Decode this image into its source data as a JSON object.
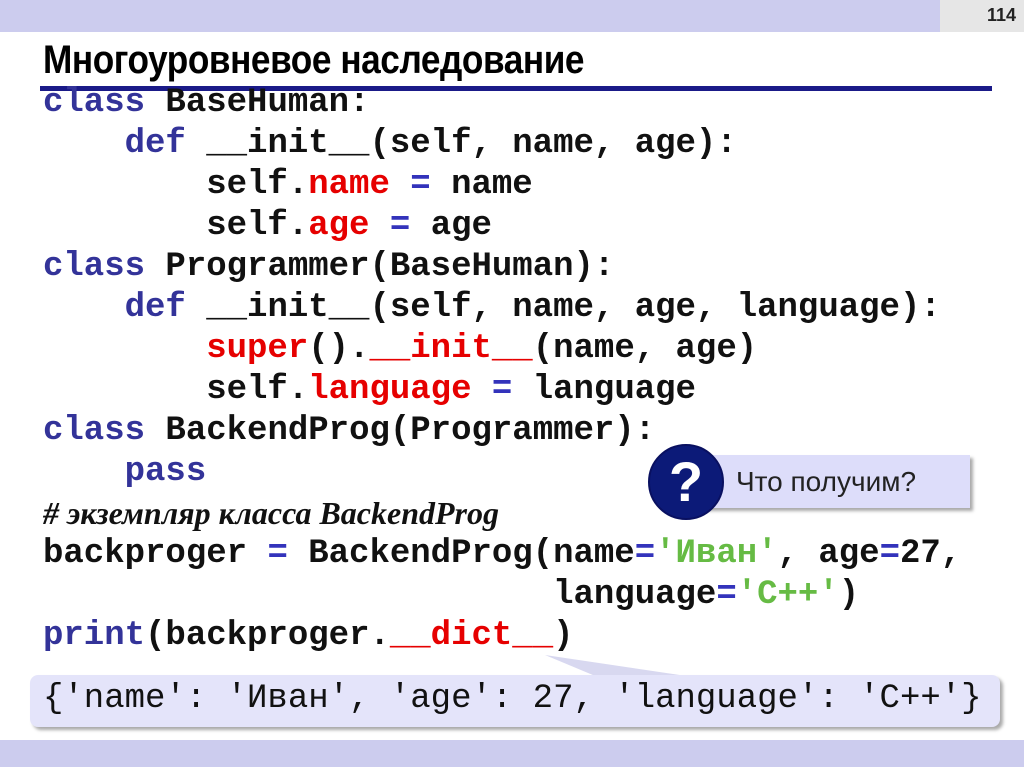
{
  "slide": {
    "page_number": "114",
    "title": "Многоуровневое наследование"
  },
  "colors": {
    "keyword": "#333399",
    "highlight": "#e60000",
    "string": "#66bb44",
    "accent": "#ccccee",
    "question": "#0c1a78"
  },
  "code": {
    "lines": [
      {
        "tokens": [
          {
            "text": "class",
            "c": "k"
          },
          {
            "text": " BaseHuman:",
            "c": "n"
          }
        ]
      },
      {
        "tokens": [
          {
            "text": "    def",
            "c": "k"
          },
          {
            "text": " __init__(self, name, age):",
            "c": "n"
          }
        ]
      },
      {
        "tokens": [
          {
            "text": "        self.",
            "c": "n"
          },
          {
            "text": "name",
            "c": "r"
          },
          {
            "text": " = ",
            "c": "o"
          },
          {
            "text": "name",
            "c": "n"
          }
        ]
      },
      {
        "tokens": [
          {
            "text": "        self.",
            "c": "n"
          },
          {
            "text": "age",
            "c": "r"
          },
          {
            "text": " = ",
            "c": "o"
          },
          {
            "text": "age",
            "c": "n"
          }
        ]
      },
      {
        "tokens": [
          {
            "text": "class",
            "c": "k"
          },
          {
            "text": " Programmer(BaseHuman):",
            "c": "n"
          }
        ]
      },
      {
        "tokens": [
          {
            "text": "    def",
            "c": "k"
          },
          {
            "text": " __init__(self, name, age, language):",
            "c": "n"
          }
        ]
      },
      {
        "tokens": [
          {
            "text": "        super",
            "c": "r"
          },
          {
            "text": "().",
            "c": "n"
          },
          {
            "text": "__init__",
            "c": "r"
          },
          {
            "text": "(name, age)",
            "c": "n"
          }
        ]
      },
      {
        "tokens": [
          {
            "text": "        self.",
            "c": "n"
          },
          {
            "text": "language",
            "c": "r"
          },
          {
            "text": " = ",
            "c": "o"
          },
          {
            "text": "language",
            "c": "n"
          }
        ]
      },
      {
        "tokens": [
          {
            "text": "class",
            "c": "k"
          },
          {
            "text": " BackendProg(Programmer):",
            "c": "n"
          }
        ]
      },
      {
        "tokens": [
          {
            "text": "    pass",
            "c": "k"
          }
        ]
      },
      {
        "comment": "# экземпляр класса BackendProg",
        "tokens": []
      },
      {
        "tokens": [
          {
            "text": "backproger ",
            "c": "n"
          },
          {
            "text": "=",
            "c": "o"
          },
          {
            "text": " BackendProg(name",
            "c": "n"
          },
          {
            "text": "=",
            "c": "o"
          },
          {
            "text": "'Иван'",
            "c": "g"
          },
          {
            "text": ", age",
            "c": "n"
          },
          {
            "text": "=",
            "c": "o"
          },
          {
            "text": "27,",
            "c": "n"
          }
        ]
      },
      {
        "tokens": [
          {
            "text": "                         language",
            "c": "n"
          },
          {
            "text": "=",
            "c": "o"
          },
          {
            "text": "'C++'",
            "c": "g"
          },
          {
            "text": ")",
            "c": "n"
          }
        ]
      },
      {
        "tokens": [
          {
            "text": "print",
            "c": "k"
          },
          {
            "text": "(backproger.",
            "c": "n"
          },
          {
            "text": "__dict__",
            "c": "r"
          },
          {
            "text": ")",
            "c": "n"
          }
        ]
      }
    ]
  },
  "callout": {
    "icon": "question-mark-icon",
    "symbol": "?",
    "text": "Что получим?"
  },
  "output": {
    "text": "{'name': 'Иван', 'age': 27, 'language': 'C++'}"
  }
}
